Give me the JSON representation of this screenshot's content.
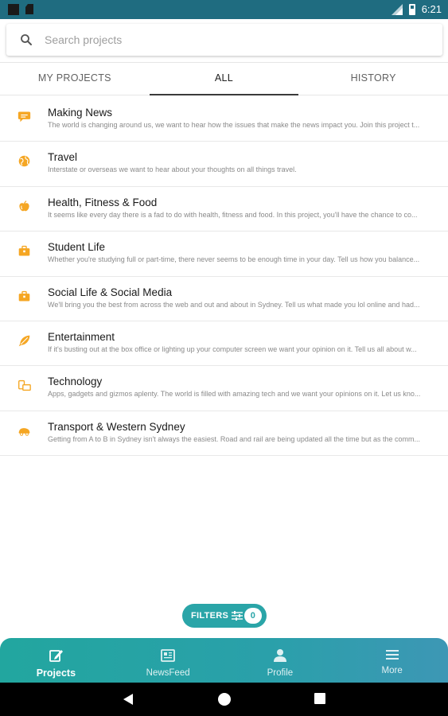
{
  "status_bar": {
    "time": "6:21"
  },
  "search": {
    "placeholder": "Search projects",
    "value": ""
  },
  "tabs": [
    {
      "label": "MY PROJECTS",
      "active": false
    },
    {
      "label": "ALL",
      "active": true
    },
    {
      "label": "HISTORY",
      "active": false
    }
  ],
  "projects": [
    {
      "title": "Making News",
      "description": "The world is changing around us, we want to hear how the issues that make the news impact you. Join this project t...",
      "icon": "speech-bubble-icon"
    },
    {
      "title": "Travel",
      "description": "Interstate or overseas we want to hear about your thoughts on all things travel.",
      "icon": "globe-icon"
    },
    {
      "title": "Health, Fitness & Food",
      "description": "It seems like every day there is a fad to do with health, fitness and food. In this project, you'll have the chance to co...",
      "icon": "apple-icon"
    },
    {
      "title": "Student Life",
      "description": "Whether you're studying full or part-time, there never seems to be enough time in your day. Tell us how you balance...",
      "icon": "briefcase-icon"
    },
    {
      "title": "Social Life & Social Media",
      "description": "We'll bring you the best from across the web and out and about in Sydney. Tell us what made you lol online and had...",
      "icon": "briefcase-icon"
    },
    {
      "title": "Entertainment",
      "description": "If it's busting out at the box office or lighting up your computer screen we want your opinion on it. Tell us all about w...",
      "icon": "feather-icon"
    },
    {
      "title": "Technology",
      "description": "Apps, gadgets and gizmos aplenty. The world is filled with amazing tech and we want your opinions on it. Let us kno...",
      "icon": "devices-icon"
    },
    {
      "title": "Transport & Western Sydney",
      "description": "Getting from A to B in Sydney isn't always the easiest. Road and rail are being updated all the time but as the comm...",
      "icon": "car-icon"
    }
  ],
  "filters": {
    "label": "FILTERS",
    "count": "0"
  },
  "bottom_nav": [
    {
      "label": "Projects",
      "icon": "edit-icon",
      "active": true
    },
    {
      "label": "NewsFeed",
      "icon": "newspaper-icon",
      "active": false
    },
    {
      "label": "Profile",
      "icon": "person-icon",
      "active": false
    },
    {
      "label": "More",
      "icon": "menu-icon",
      "active": false
    }
  ],
  "colors": {
    "accent": "#2aa5a8",
    "icon_orange": "#f5a623",
    "status_bar": "#1f6c80"
  }
}
